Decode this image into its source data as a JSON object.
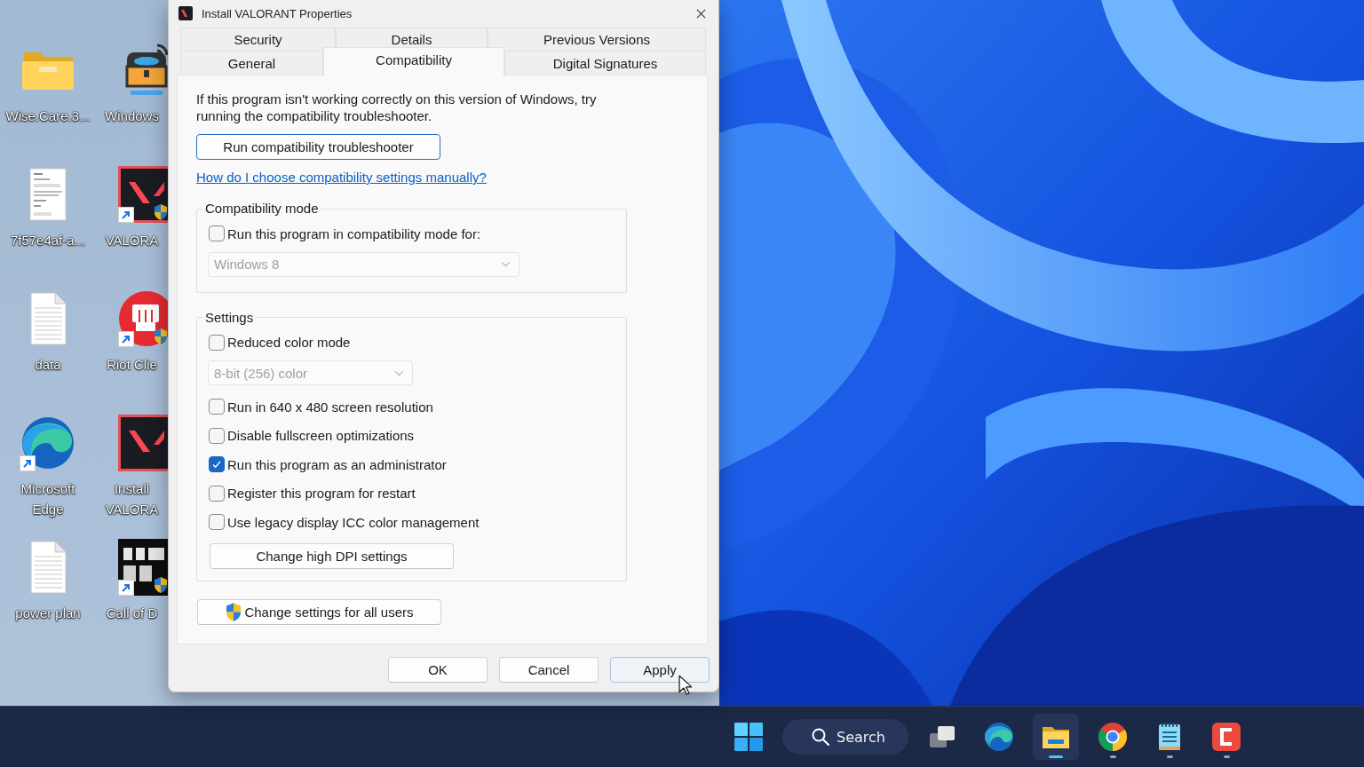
{
  "desktop": {
    "icons": [
      {
        "label": "Wise.Care.3...",
        "kind": "folder",
        "shortcut": false,
        "shield": false
      },
      {
        "label": "Windows",
        "kind": "chest",
        "shortcut": false,
        "shield": false
      },
      {
        "label": "7f57e4af-a...",
        "kind": "document",
        "shortcut": false,
        "shield": false
      },
      {
        "label": "VALORA",
        "kind": "vlogo",
        "shortcut": true,
        "shield": true
      },
      {
        "label": "data",
        "kind": "textfile",
        "shortcut": false,
        "shield": false
      },
      {
        "label": "Riot Clie",
        "kind": "fist",
        "shortcut": true,
        "shield": true
      },
      {
        "label": "Microsoft Edge",
        "kind": "browser",
        "shortcut": true,
        "shield": false
      },
      {
        "label": "Install VALORA",
        "kind": "vlogo",
        "shortcut": false,
        "shield": false
      },
      {
        "label": "power plan",
        "kind": "textfile",
        "shortcut": false,
        "shield": false
      },
      {
        "label": "Call of D",
        "kind": "mwlogo",
        "shortcut": true,
        "shield": true
      }
    ]
  },
  "dialog": {
    "title": "Install VALORANT Properties",
    "tab_rows": [
      {
        "tabs": [
          {
            "label": "Security",
            "selected": false
          },
          {
            "label": "Details",
            "selected": false
          },
          {
            "label": "Previous Versions",
            "selected": false
          }
        ]
      },
      {
        "tabs": [
          {
            "label": "General",
            "selected": false
          },
          {
            "label": "Compatibility",
            "selected": true
          },
          {
            "label": "Digital Signatures",
            "selected": false
          }
        ]
      }
    ],
    "intro": "If this program isn't working correctly on this version of Windows, try running the compatibility troubleshooter.",
    "troubleshooter_button": {
      "label": "Run compatibility troubleshooter",
      "focused": true
    },
    "help_link": "How do I choose compatibility settings manually?",
    "groups": [
      {
        "title": "Compatibility mode",
        "items": [
          {
            "kind": "checkbox",
            "label": "Run this program in compatibility mode for:",
            "checked": false
          },
          {
            "kind": "dropdown",
            "value": "Windows 8",
            "disabled": true
          }
        ]
      },
      {
        "title": "Settings",
        "items": [
          {
            "kind": "checkbox",
            "label": "Reduced color mode",
            "checked": false
          },
          {
            "kind": "dropdown",
            "value": "8-bit (256) color",
            "disabled": true
          },
          {
            "kind": "checkbox",
            "label": "Run in 640 x 480 screen resolution",
            "checked": false
          },
          {
            "kind": "checkbox",
            "label": "Disable fullscreen optimizations",
            "checked": false
          },
          {
            "kind": "checkbox",
            "label": "Run this program as an administrator",
            "checked": true
          },
          {
            "kind": "checkbox",
            "label": "Register this program for restart",
            "checked": false
          },
          {
            "kind": "checkbox",
            "label": "Use legacy display ICC color management",
            "checked": false
          },
          {
            "kind": "button",
            "label": "Change high DPI settings"
          }
        ]
      }
    ],
    "all_users_button": {
      "label": "Change settings for all users",
      "shield": true
    },
    "buttons": [
      {
        "label": "OK",
        "hovered": false
      },
      {
        "label": "Cancel",
        "hovered": false
      },
      {
        "label": "Apply",
        "hovered": true
      }
    ]
  },
  "taskbar": {
    "items": [
      {
        "kind": "start"
      },
      {
        "kind": "search",
        "placeholder": "Search"
      },
      {
        "kind": "taskview",
        "running": false,
        "active": false
      },
      {
        "kind": "browser",
        "running": false,
        "active": false
      },
      {
        "kind": "folder",
        "running": true,
        "active": true
      },
      {
        "kind": "chrome",
        "running": true,
        "active": false
      },
      {
        "kind": "notepad",
        "running": true,
        "active": false
      },
      {
        "kind": "bracket",
        "running": true,
        "active": false
      }
    ]
  }
}
